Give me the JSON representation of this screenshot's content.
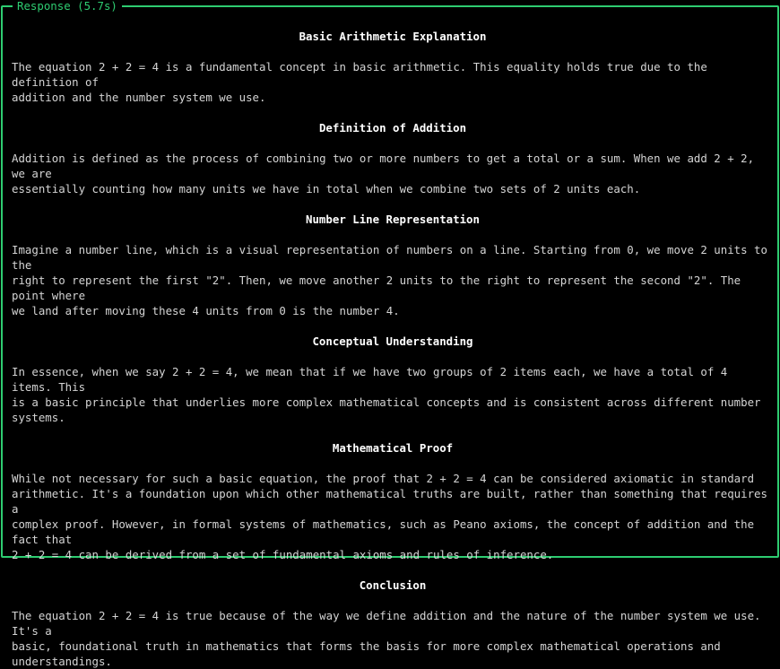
{
  "panel": {
    "title": "Response (5.7s)",
    "border_color": "#2ecc71"
  },
  "sections": [
    {
      "heading": "Basic Arithmetic Explanation",
      "lines": [
        "The equation 2 + 2 = 4 is a fundamental concept in basic arithmetic. This equality holds true due to the definition of",
        "addition and the number system we use."
      ]
    },
    {
      "heading": "Definition of Addition",
      "lines": [
        "Addition is defined as the process of combining two or more numbers to get a total or a sum. When we add 2 + 2, we are",
        "essentially counting how many units we have in total when we combine two sets of 2 units each."
      ]
    },
    {
      "heading": "Number Line Representation",
      "lines": [
        "Imagine a number line, which is a visual representation of numbers on a line. Starting from 0, we move 2 units to the",
        "right to represent the first \"2\". Then, we move another 2 units to the right to represent the second \"2\". The point where",
        "we land after moving these 4 units from 0 is the number 4."
      ]
    },
    {
      "heading": "Conceptual Understanding",
      "lines": [
        "In essence, when we say 2 + 2 = 4, we mean that if we have two groups of 2 items each, we have a total of 4 items. This",
        "is a basic principle that underlies more complex mathematical concepts and is consistent across different number systems."
      ]
    },
    {
      "heading": "Mathematical Proof",
      "lines": [
        "While not necessary for such a basic equation, the proof that 2 + 2 = 4 can be considered axiomatic in standard",
        "arithmetic. It's a foundation upon which other mathematical truths are built, rather than something that requires a",
        "complex proof. However, in formal systems of mathematics, such as Peano axioms, the concept of addition and the fact that",
        "2 + 2 = 4 can be derived from a set of fundamental axioms and rules of inference."
      ]
    },
    {
      "heading": "Conclusion",
      "lines": [
        "The equation 2 + 2 = 4 is true because of the way we define addition and the nature of the number system we use. It's a",
        "basic, foundational truth in mathematics that forms the basis for more complex mathematical operations and",
        "understandings."
      ]
    }
  ]
}
